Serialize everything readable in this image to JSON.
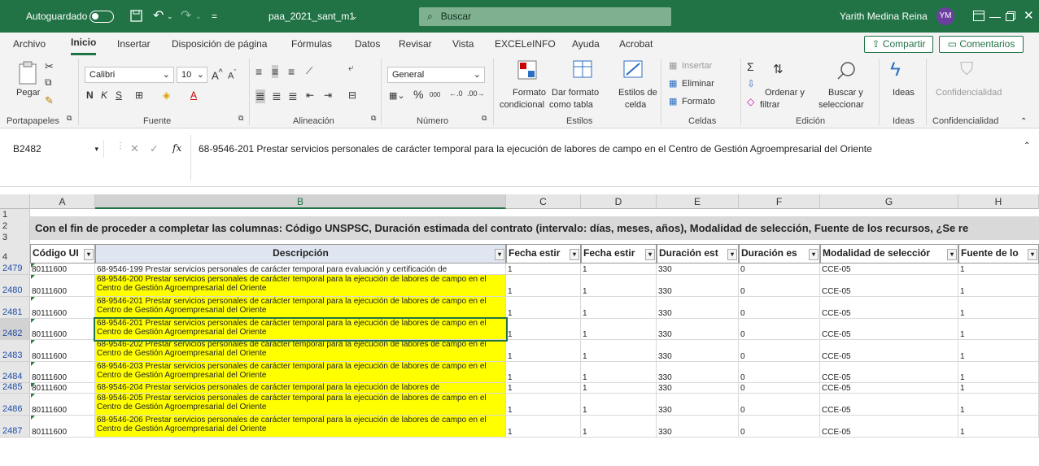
{
  "titlebar": {
    "autosave_label": "Autoguardado",
    "filename": "paa_2021_sant_m1",
    "search_placeholder": "Buscar",
    "user_name": "Yarith Medina Reina",
    "user_initials": "YM"
  },
  "menu": {
    "tabs": [
      "Archivo",
      "Inicio",
      "Insertar",
      "Disposición de página",
      "Fórmulas",
      "Datos",
      "Revisar",
      "Vista",
      "EXCELeINFO",
      "Ayuda",
      "Acrobat"
    ],
    "share": "Compartir",
    "comments": "Comentarios"
  },
  "ribbon": {
    "paste": "Pegar",
    "font_name": "Calibri",
    "font_size": "10",
    "number_format": "General",
    "format_conditional_1": "Formato",
    "format_conditional_2": "condicional",
    "format_table_1": "Dar formato",
    "format_table_2": "como tabla",
    "cell_styles_1": "Estilos de",
    "cell_styles_2": "celda",
    "insert": "Insertar",
    "delete": "Eliminar",
    "format": "Formato",
    "sort_1": "Ordenar y",
    "sort_2": "filtrar",
    "find_1": "Buscar y",
    "find_2": "seleccionar",
    "ideas": "Ideas",
    "sensitivity": "Confidencialidad",
    "groups": {
      "clipboard": "Portapapeles",
      "font": "Fuente",
      "alignment": "Alineación",
      "number": "Número",
      "styles": "Estilos",
      "cells": "Celdas",
      "editing": "Edición",
      "ideas": "Ideas",
      "sensitivity": "Confidencialidad"
    }
  },
  "formula_bar": {
    "name_box": "B2482",
    "fx": "fx",
    "content": "68-9546-201 Prestar servicios personales de carácter temporal para la ejecución de labores de campo en el Centro de Gestión Agroempresarial del Oriente"
  },
  "grid": {
    "columns": [
      "A",
      "B",
      "C",
      "D",
      "E",
      "F",
      "G",
      "H"
    ],
    "banner_rows": [
      "1",
      "2",
      "3"
    ],
    "banner_text": "Con el fin de proceder a completar las columnas: Código UNSPSC, Duración estimada del contrato (intervalo: días, meses, años), Modalidad de selección, Fuente de los recursos, ¿Se re",
    "header_row_number": "4",
    "headers": [
      "Código UI",
      "Descripción",
      "Fecha estir",
      "Fecha estir",
      "Duración est",
      "Duración es",
      "Modalidad de selecciór",
      "Fuente de lo"
    ],
    "rows": [
      {
        "num": "2479",
        "code": "80111600",
        "desc": "68-9546-199 Prestar servicios personales de carácter temporal para evaluación y certificación de",
        "c": "1",
        "d": "1",
        "e": "330",
        "f": "0",
        "g": "CCE-05",
        "h": "1",
        "highlight": false
      },
      {
        "num": "2480",
        "code": "80111600",
        "desc": "68-9546-200 Prestar servicios personales de carácter temporal para la ejecución de labores de campo en el Centro de Gestión Agroempresarial del Oriente",
        "c": "1",
        "d": "1",
        "e": "330",
        "f": "0",
        "g": "CCE-05",
        "h": "1",
        "highlight": true
      },
      {
        "num": "2481",
        "code": "80111600",
        "desc": "68-9546-201 Prestar servicios personales de carácter temporal para la ejecución de labores de campo en el Centro de Gestión Agroempresarial del Oriente",
        "c": "1",
        "d": "1",
        "e": "330",
        "f": "0",
        "g": "CCE-05",
        "h": "1",
        "highlight": true
      },
      {
        "num": "2482",
        "code": "80111600",
        "desc": "68-9546-201 Prestar servicios personales de carácter temporal para la ejecución de labores de campo en el Centro de Gestión Agroempresarial del Oriente",
        "c": "1",
        "d": "1",
        "e": "330",
        "f": "0",
        "g": "CCE-05",
        "h": "1",
        "highlight": true
      },
      {
        "num": "2483",
        "code": "80111600",
        "desc": "68-9546-202 Prestar servicios personales de carácter temporal para la ejecución de labores de campo en el Centro de Gestión Agroempresarial del Oriente",
        "c": "1",
        "d": "1",
        "e": "330",
        "f": "0",
        "g": "CCE-05",
        "h": "1",
        "highlight": true
      },
      {
        "num": "2484",
        "code": "80111600",
        "desc": "68-9546-203 Prestar servicios personales de carácter temporal para la ejecución de labores de campo en el Centro de Gestión Agroempresarial del Oriente",
        "c": "1",
        "d": "1",
        "e": "330",
        "f": "0",
        "g": "CCE-05",
        "h": "1",
        "highlight": true
      },
      {
        "num": "2485",
        "code": "80111600",
        "desc": "68-9546-204 Prestar servicios personales de carácter temporal para la ejecución de labores de",
        "c": "1",
        "d": "1",
        "e": "330",
        "f": "0",
        "g": "CCE-05",
        "h": "1",
        "highlight": true
      },
      {
        "num": "2486",
        "code": "80111600",
        "desc": "68-9546-205 Prestar servicios personales de carácter temporal para la ejecución de labores de campo en el Centro de Gestión Agroempresarial del Oriente",
        "c": "1",
        "d": "1",
        "e": "330",
        "f": "0",
        "g": "CCE-05",
        "h": "1",
        "highlight": true
      },
      {
        "num": "2487",
        "code": "80111600",
        "desc": "68-9546-206 Prestar servicios personales de carácter temporal para la ejecución de labores de campo en el Centro de Gestión Agroempresarial del Oriente",
        "c": "1",
        "d": "1",
        "e": "330",
        "f": "0",
        "g": "CCE-05",
        "h": "1",
        "highlight": true
      }
    ]
  }
}
